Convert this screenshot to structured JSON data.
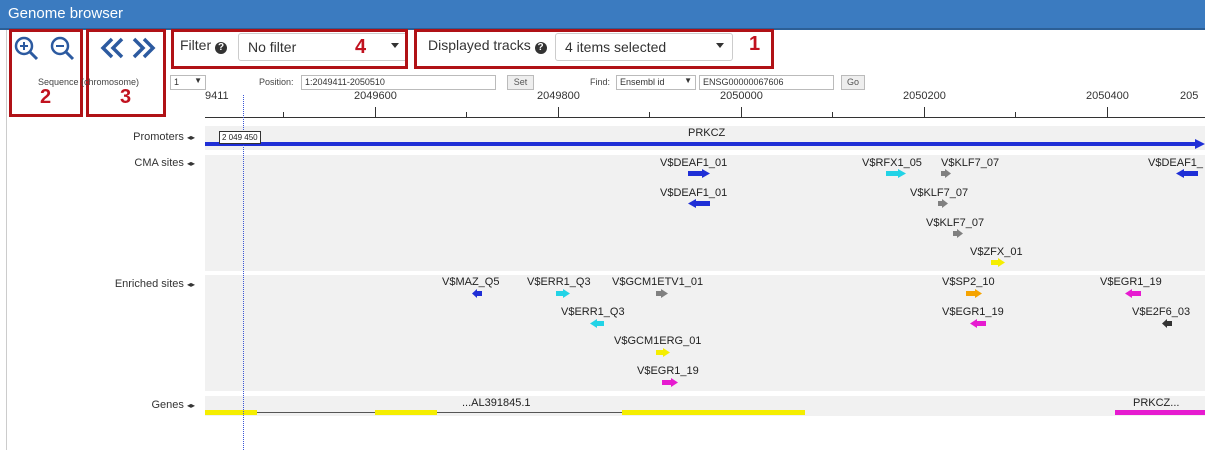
{
  "window": {
    "title": "Genome browser"
  },
  "toolbar": {
    "filter_label": "Filter",
    "filter_value": "No filter",
    "tracks_label": "Displayed tracks",
    "tracks_value": "4 items selected"
  },
  "annotations": {
    "n1": "1",
    "n2": "2",
    "n3": "3",
    "n4": "4"
  },
  "controls": {
    "sequence_label": "Sequence (chromosome)",
    "sequence_value": "1",
    "position_label": "Position:",
    "position_value": "1:2049411-2050510",
    "set_button": "Set",
    "find_label": "Find:",
    "find_type": "Ensembl id",
    "find_value": "ENSG00000067606",
    "go_button": "Go"
  },
  "ruler": {
    "ticks": [
      "9411",
      "2049600",
      "2049800",
      "2050000",
      "2050200",
      "2050400",
      "205"
    ]
  },
  "cursor_label": "2 049 450",
  "tracks": {
    "promoters": {
      "label": "Promoters",
      "gene": "PRKCZ"
    },
    "cma": {
      "label": "CMA sites",
      "sites": [
        "V$DEAF1_01",
        "V$DEAF1_01",
        "V$RFX1_05",
        "V$KLF7_07",
        "V$KLF7_07",
        "V$KLF7_07",
        "V$ZFX_01",
        "V$DEAF1_"
      ]
    },
    "enriched": {
      "label": "Enriched sites",
      "sites": [
        "V$MAZ_Q5",
        "V$ERR1_Q3",
        "V$GCM1ETV1_01",
        "V$ERR1_Q3",
        "V$GCM1ERG_01",
        "V$EGR1_19",
        "V$SP2_10",
        "V$EGR1_19",
        "V$EGR1_19",
        "V$E2F6_03"
      ]
    },
    "genes": {
      "label": "Genes",
      "gene1": "...AL391845.1",
      "gene2": "PRKCZ..."
    }
  },
  "colors": {
    "title_bar": "#3b7bc0",
    "annotation_red": "#b01116",
    "blue": "#1f2fd6",
    "cyan": "#22d3e6",
    "gray": "#808080",
    "yellow": "#f5ee00",
    "orange": "#f5a300",
    "magenta": "#e61bd0",
    "black": "#333333"
  }
}
